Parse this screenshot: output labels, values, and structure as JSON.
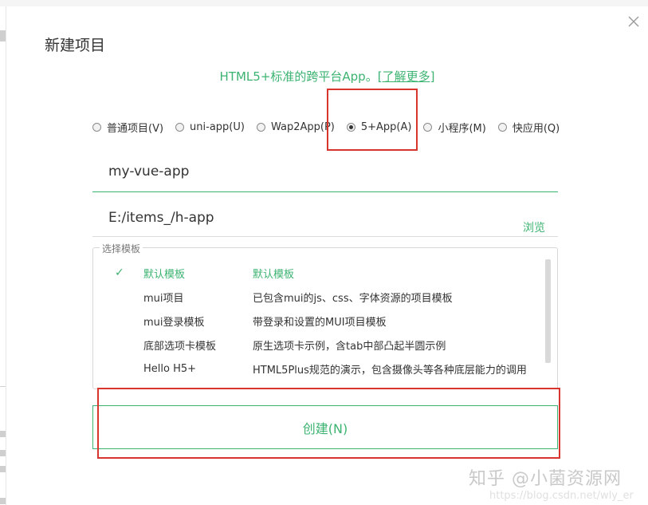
{
  "dialog": {
    "title": "新建项目",
    "subtitle_text": "HTML5+标准的跨平台App。",
    "subtitle_link": "[了解更多]"
  },
  "project_types": [
    {
      "label": "普通项目(V)",
      "checked": false
    },
    {
      "label": "uni-app(U)",
      "checked": false
    },
    {
      "label": "Wap2App(P)",
      "checked": false
    },
    {
      "label": "5+App(A)",
      "checked": true
    },
    {
      "label": "小程序(M)",
      "checked": false
    },
    {
      "label": "快应用(Q)",
      "checked": false
    }
  ],
  "form": {
    "project_name": "my-vue-app",
    "project_path": "E:/items_/h-app",
    "browse_label": "浏览"
  },
  "templates": {
    "legend": "选择模板",
    "items": [
      {
        "name": "默认模板",
        "desc": "默认模板",
        "selected": true
      },
      {
        "name": "mui项目",
        "desc": "已包含mui的js、css、字体资源的项目模板",
        "selected": false
      },
      {
        "name": "mui登录模板",
        "desc": "带登录和设置的MUI项目模板",
        "selected": false
      },
      {
        "name": "底部选项卡模板",
        "desc": "原生选项卡示例，含tab中部凸起半圆示例",
        "selected": false
      },
      {
        "name": "Hello H5+",
        "desc": "HTML5Plus规范的演示，包含摄像头等各种底层能力的调用",
        "selected": false
      }
    ],
    "check_mark": "✓"
  },
  "actions": {
    "create_label": "创建(N)"
  },
  "watermark": {
    "text": "知乎 @小菌资源网",
    "url": "https://blog.csdn.net/wly_er"
  },
  "colors": {
    "accent": "#3cb371",
    "highlight": "#d9352f"
  }
}
